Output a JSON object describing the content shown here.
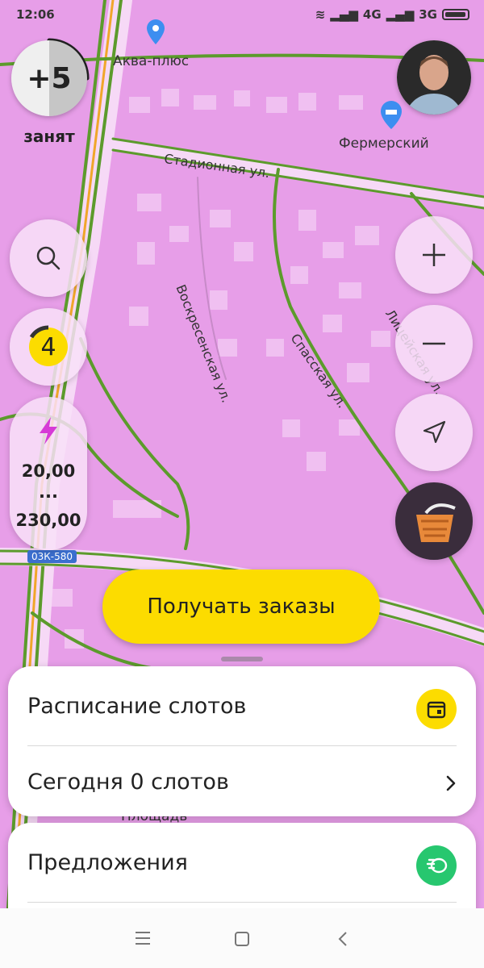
{
  "status_bar": {
    "time": "12:06",
    "network_1": "4G",
    "network_2": "3G"
  },
  "map": {
    "labels": {
      "akva": "Аква-плюс",
      "fermerskiy": "Фермерский",
      "stadionnaya": "Стадионная ул.",
      "voskresenskaya": "Воскресенская ул.",
      "spasskaya": "Спасская ул.",
      "liceyskaya": "Лицейская ул.",
      "road_code": "03К-580",
      "ploshchad": "Площадь"
    }
  },
  "driver": {
    "rating_delta": "+5",
    "status": "занят",
    "queue_count": "4"
  },
  "surge": {
    "min": "20,00",
    "dots": "...",
    "max": "230,00"
  },
  "cta": {
    "label": "Получать заказы"
  },
  "slots_card": {
    "title": "Расписание слотов",
    "today": "Сегодня 0 слотов"
  },
  "offers_card": {
    "title": "Предложения"
  },
  "icons": [
    "search-icon",
    "plus-icon",
    "minus-icon",
    "navigate-icon",
    "lightning-icon",
    "calendar-icon",
    "coins-icon",
    "chevron-right-icon",
    "basket-icon",
    "pin-icon",
    "hotel-icon",
    "menu-icon",
    "home-icon",
    "back-icon"
  ],
  "colors": {
    "map_bg": "#e79ee8",
    "road": "#5c9b2c",
    "accent": "#fcdc00",
    "offers_icon": "#27c76f",
    "surge": "#d63ad6"
  }
}
